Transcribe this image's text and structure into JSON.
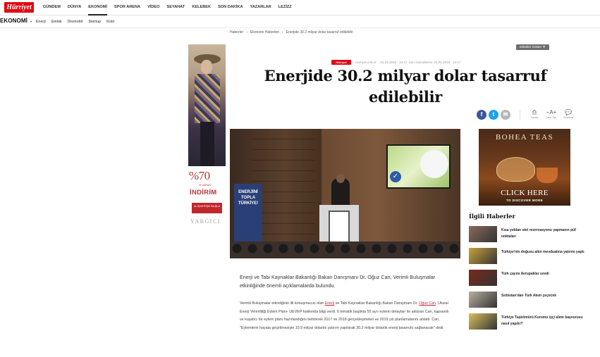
{
  "logo": "Hürriyet",
  "nav": {
    "items": [
      "GÜNDEM",
      "DÜNYA",
      "EKONOMİ",
      "SPOR ARENA",
      "VİDEO",
      "SEYAHAT",
      "KELEBEK",
      "SON DAKİKA",
      "YAZARLAR",
      "LEZİZZ"
    ],
    "active_index": 2
  },
  "section": {
    "title": "EKONOMİ",
    "items": [
      "Enerji",
      "Emlak",
      "Otomobil",
      "Startup",
      "Kobi"
    ]
  },
  "breadcrumb": [
    "Haberler",
    "›",
    "Ekonomi Haberleri",
    "›",
    "Enerjide 30.2 milyar dolar tasarruf edilebilir"
  ],
  "left_ad": {
    "percent": "%70",
    "small": "'E VARAN",
    "headline": "İNDİRİM",
    "button": "ALIŞVERİŞE BAŞLA",
    "brand": "YARGICI"
  },
  "tags_button": "Etiketler Göster ▼",
  "meta": {
    "source_logo": "Hürriyet",
    "source": "Hurriyet.com.tr",
    "dates": "01.02.2018 - 14:17, Son Güncelleme: 01.02.2018 - 14:17"
  },
  "headline": "Enerjide 30.2 milyar dolar tasarruf edilebilir",
  "share": {
    "facebook": "f",
    "twitter": "t",
    "email": "✉"
  },
  "tools": [
    {
      "icon": "print-icon",
      "glyph": "⎙",
      "label": "Yazdır"
    },
    {
      "icon": "font-size-icon",
      "glyph": "−A+",
      "label": "Yazı Tipi"
    },
    {
      "icon": "comment-icon",
      "glyph": "💬",
      "label": "Yorumlar"
    }
  ],
  "photo": {
    "banner_text": "ENERJİNİ TOPLA TÜRKİYE!"
  },
  "lead": "Enerji ve Tabi Kaynaklar Bakanlığı Bakan Danışmanı Dr. Oğuz Can, Verimli Buluşmalar etkinliğinde önemli açıklamalarda bulundu.",
  "body": {
    "p1_a": "Verimli Buluşmalar etkinliğinin ilk konuşmacısı olan ",
    "link1": "Enerji",
    "p1_b": " ve Tabi Kaynaklar Bakanlığı Bakan Danışmanı Dr. ",
    "link2": "Oğuz Can",
    "p1_c": ", Ulusal Enerji Verimliliği Eylem Planı- UEVEP hakkında bilgi verdi. 6 tematik başlıkta 55 ayrı eylemi detayları ile aktaran Can, kapsamlı ve kuşatıcı bir eylem planı hazırlandığını belirterek 2017 ve 2018 gerçekleşmeleri ve 2019 yılı planlamalarını anlattı. Can, \"Eylemlerin hayata geçirilmesiyle 10.9 milyar dolarlık yatırım yapılarak 30.2 milyar dolarlık enerji tasarrufu sağlanacak\" dedi."
  },
  "right_ad": {
    "brand": "BOHEA TEAS",
    "cta": "CLICK HERE",
    "sub": "TO DISCOVER MORE"
  },
  "related": {
    "title": "İlgili Haberler",
    "items": [
      {
        "text": "Kısa yoldan otel rezervasyonu yapmanın püf noktaları",
        "color": "#8a6a5a"
      },
      {
        "text": "Türkiye'nin doğusu altın mevduatına yatırım yaptı",
        "color": "#c9a23a"
      },
      {
        "text": "Türk çayını Avrupalılar sevdi",
        "color": "#7a2a1a"
      },
      {
        "text": "Sırbistan'dan Türk Akım çeçecek",
        "color": "#b7b0a0"
      },
      {
        "text": "Türkiye Taşkömürü Kurumu işçi alımı başvurusu nasıl yapılır?",
        "color": "#d9c060"
      }
    ]
  }
}
